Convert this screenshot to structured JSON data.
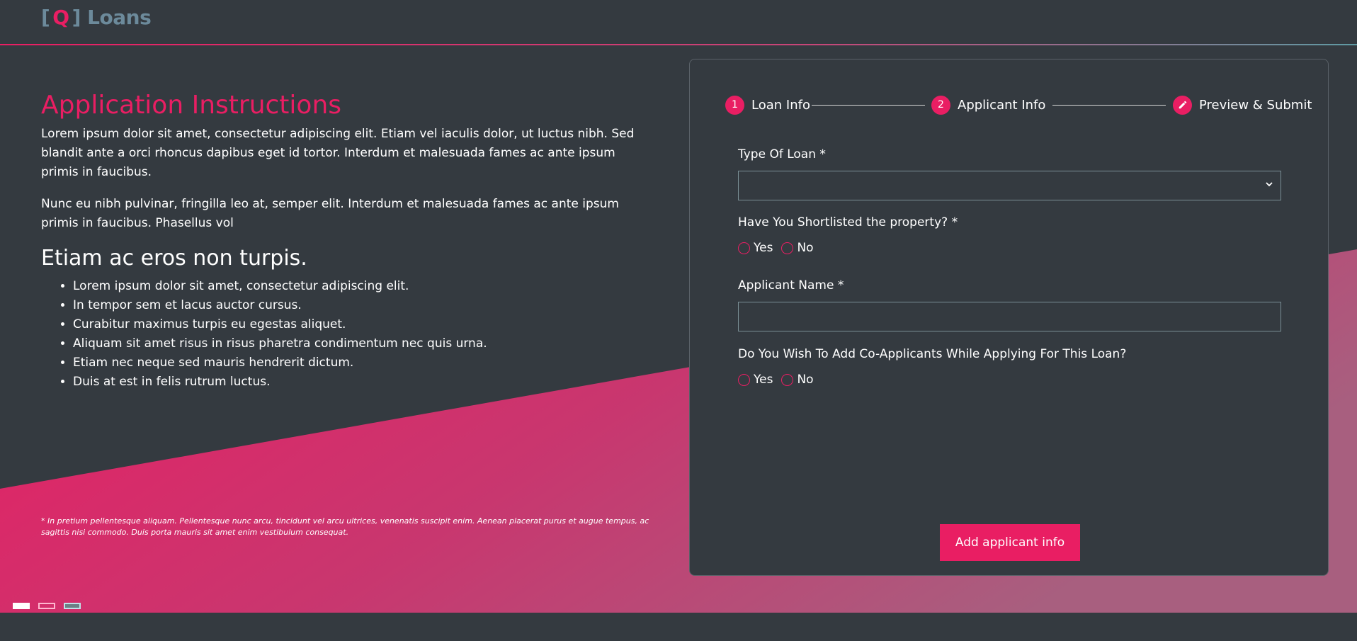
{
  "brand": {
    "bracket_open": "[",
    "q": "Q",
    "bracket_close": "]",
    "name": "Loans",
    "accent": "#e91e63"
  },
  "instructions": {
    "title": "Application Instructions",
    "paragraph1": "Lorem ipsum dolor sit amet, consectetur adipiscing elit. Etiam vel iaculis dolor, ut luctus nibh. Sed blandit ante a orci rhoncus dapibus eget id tortor. Interdum et malesuada fames ac ante ipsum primis in faucibus.",
    "paragraph2": "Nunc eu nibh pulvinar, fringilla leo at, semper elit. Interdum et malesuada fames ac ante ipsum primis in faucibus. Phasellus vol",
    "subtitle": "Etiam ac eros non turpis.",
    "bullets": [
      "Lorem ipsum dolor sit amet, consectetur adipiscing elit.",
      "In tempor sem et lacus auctor cursus.",
      "Curabitur maximus turpis eu egestas aliquet.",
      "Aliquam sit amet risus in risus pharetra condimentum nec quis urna.",
      "Etiam nec neque sed mauris hendrerit dictum.",
      "Duis at est in felis rutrum luctus."
    ],
    "footnote": "* In pretium pellentesque aliquam. Pellentesque nunc arcu, tincidunt vel arcu ultrices, venenatis suscipit enim. Aenean placerat purus et augue tempus, ac sagittis nisi commodo. Duis porta mauris sit amet enim vestibulum consequat."
  },
  "stepper": {
    "steps": [
      {
        "number": "1",
        "label": "Loan Info"
      },
      {
        "number": "2",
        "label": "Applicant Info"
      },
      {
        "number": "",
        "label": "Preview & Submit",
        "icon": "pencil-icon"
      }
    ]
  },
  "form": {
    "type_of_loan": {
      "label": "Type Of Loan *",
      "value": ""
    },
    "shortlisted": {
      "label": "Have You Shortlisted the property? *",
      "options": [
        "Yes",
        "No"
      ]
    },
    "applicant_name": {
      "label": "Applicant Name *",
      "value": ""
    },
    "co_applicants": {
      "label": "Do You Wish To Add Co-Applicants While Applying For This Loan?",
      "options": [
        "Yes",
        "No"
      ]
    },
    "submit_label": "Add applicant info"
  },
  "carousel": {
    "slides": 3,
    "active": 1
  }
}
